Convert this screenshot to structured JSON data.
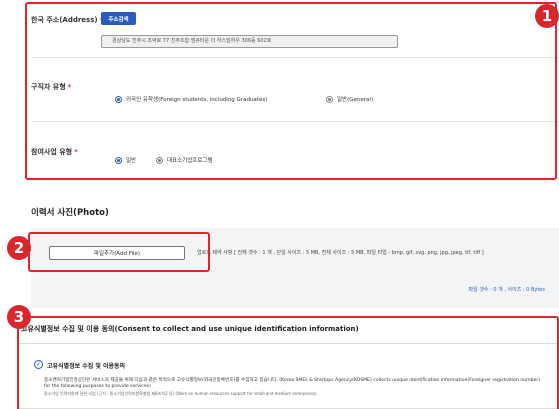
{
  "address": {
    "label": "한국 주소(Address)",
    "required_mark": "*",
    "search_button": "주소검색",
    "value": "경상남도 진주시 조억로 77 진주조합 엠큐타운 더 하스빌하우 306동 602호"
  },
  "job_seeker_type": {
    "label": "구직자 유형",
    "required_mark": "*",
    "options": [
      {
        "label": "외국인 유학생(Foreign students, including Graduates)",
        "selected": true
      },
      {
        "label": "일반(General)",
        "selected": false
      }
    ]
  },
  "project_type": {
    "label": "참여사업 유형",
    "required_mark": "*",
    "options": [
      {
        "label": "일반",
        "selected": true
      },
      {
        "label": "대표소기업프로그램",
        "selected": false
      }
    ]
  },
  "photo": {
    "section_title": "이력서 사진(Photo)",
    "add_file_button": "파일추가(Add File)",
    "limits": "업로드 제약 사항 [ 전체 갯수 : 1 개 , 단일 사이즈 : 5 MB, 전체 사이즈 : 5 MB, 파일 타입 : bmp, gif, svg, png, jpg, jpeg, tif, tiff ]",
    "file_count": "파일 갯수 : 0 개 , 사이즈 : 0 Bytes"
  },
  "consent": {
    "section_title": "고유식별정보 수집 및 이용 동의(Consent to collect and use unique identification information)",
    "heading": "고유식별정보 수집 및 이용동의",
    "body": "중소벤처기업진흥공단은 서비스의 제공을 위해 다음과 같은 목적으로 고유식별정보(외국인등록번호)를 수집하고 있습니다. (Korea SMEs & Startups Agency(KOSME) collects unique identification information(Foreigner registration number) for the following purposes to provide services)",
    "sub": "중소기업 인력지원에 관한 사업 (근거 : 중소기업인력지원특별법 제8조의2 등) (Work on human resources support for small and medium enterprises)"
  },
  "badges": [
    "1",
    "2",
    "3"
  ],
  "colors": {
    "accent": "#2a5cbf",
    "highlight_red": "#e2222c",
    "badge_red": "#d9272e"
  }
}
